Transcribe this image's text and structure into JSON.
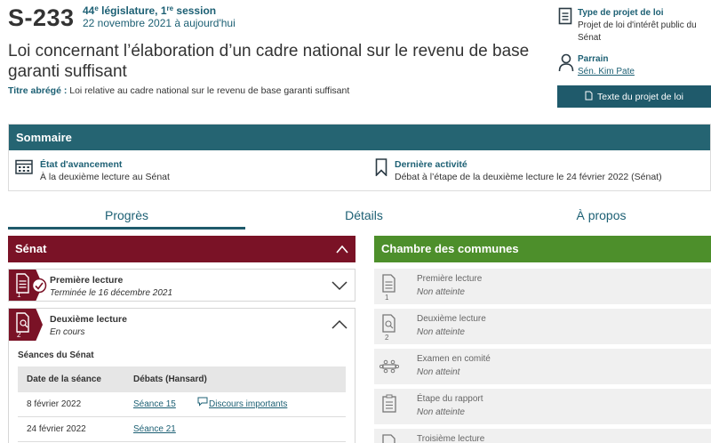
{
  "bill": {
    "number": "S-233",
    "legislature": "44e législature, 1re session",
    "legislature_parts": {
      "num": "44",
      "sup1": "e",
      "mid": " législature, 1",
      "sup2": "re",
      "end": " session"
    },
    "dates": "22 novembre 2021 à aujourd'hui",
    "title": "Loi concernant l’élaboration d’un cadre national sur le revenu de base garanti suffisant",
    "short_title_label": "Titre abrégé :",
    "short_title": "Loi relative au cadre national sur le revenu de base garanti suffisant"
  },
  "sidebar": {
    "type_label": "Type de projet de loi",
    "type_value": "Projet de loi d'intérêt public du Sénat",
    "sponsor_label": "Parrain",
    "sponsor_value": "Sén. Kim Pate",
    "text_button": "Texte du projet de loi"
  },
  "summary": {
    "header": "Sommaire",
    "status_label": "État d'avancement",
    "status_value": "À la deuxième lecture au Sénat",
    "activity_label": "Dernière activité",
    "activity_value": "Débat à l’étape de la deuxième lecture le 24 février 2022 (Sénat)"
  },
  "tabs": {
    "progress": "Progrès",
    "details": "Détails",
    "about": "À propos"
  },
  "senate": {
    "header": "Sénat",
    "first": {
      "num": "1",
      "name": "Première lecture",
      "status": "Terminée le 16 décembre 2021"
    },
    "second": {
      "num": "2",
      "name": "Deuxième lecture",
      "status": "En cours"
    },
    "sittings_title": "Séances du Sénat",
    "col_date": "Date de la séance",
    "col_debates": "Débats (Hansard)",
    "rows": [
      {
        "date": "8 février 2022",
        "sitting": "Séance 15",
        "speeches": "Discours importants"
      },
      {
        "date": "24 février 2022",
        "sitting": "Séance 21",
        "speeches": ""
      }
    ]
  },
  "commons": {
    "header": "Chambre des communes",
    "stages": [
      {
        "num": "1",
        "name": "Première lecture",
        "status": "Non atteinte"
      },
      {
        "num": "2",
        "name": "Deuxième lecture",
        "status": "Non atteinte"
      },
      {
        "num": "",
        "name": "Examen en comité",
        "status": "Non atteint"
      },
      {
        "num": "",
        "name": "Étape du rapport",
        "status": "Non atteinte"
      },
      {
        "num": "",
        "name": "Troisième lecture",
        "status": ""
      }
    ]
  },
  "colors": {
    "senate": "#7a1226",
    "commons": "#4d8f2b",
    "accent": "#1d6074",
    "summary": "#256472"
  }
}
